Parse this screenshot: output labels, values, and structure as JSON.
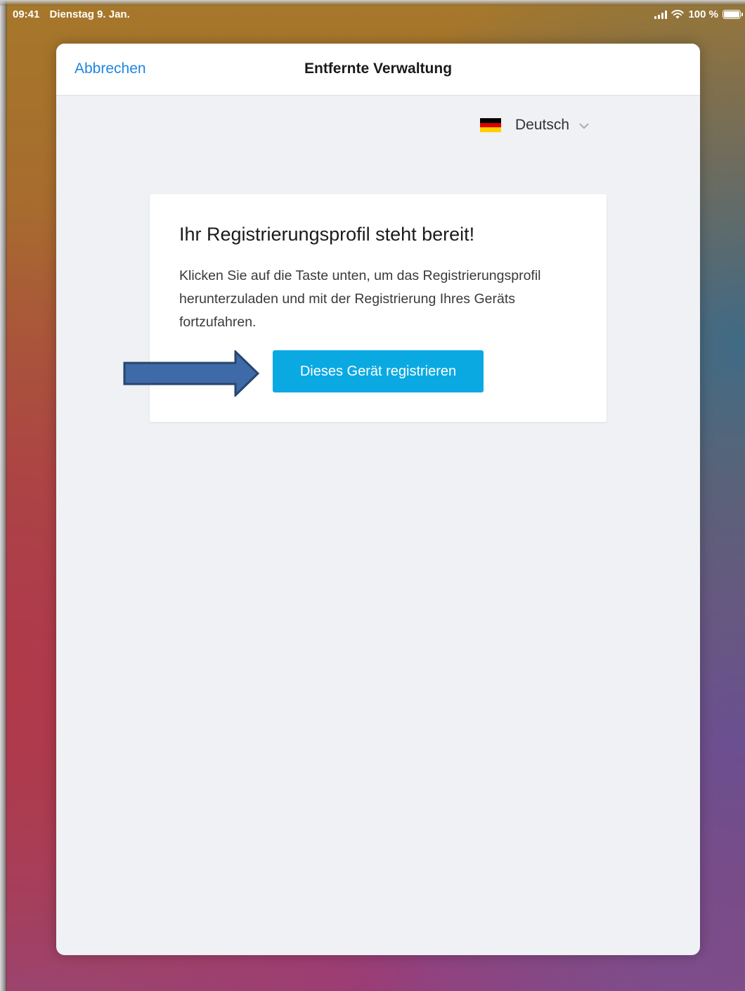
{
  "status_bar": {
    "time": "09:41",
    "date": "Dienstag 9. Jan.",
    "battery": "100 %",
    "icons": [
      "signal-icon",
      "wifi-icon",
      "battery-icon"
    ]
  },
  "nav_bar": {
    "cancel_label": "Abbrechen",
    "title": "Entfernte Verwaltung"
  },
  "language": {
    "selected": "Deutsch",
    "flag": "german-flag-icon"
  },
  "card": {
    "title": "Ihr Registrierungsprofil steht bereit!",
    "text": "Klicken Sie auf die Taste unten, um das Registrierungsprofil herunterzuladen und mit der Registrierung Ihres Geräts fortzufahren.",
    "button_label": "Dieses Gerät registrieren"
  },
  "colors": {
    "accent_link": "#1f86e0",
    "button": "#0ba9e2",
    "annotation_arrow": "#3f6aa8",
    "sheet_background": "#eff1f4"
  }
}
